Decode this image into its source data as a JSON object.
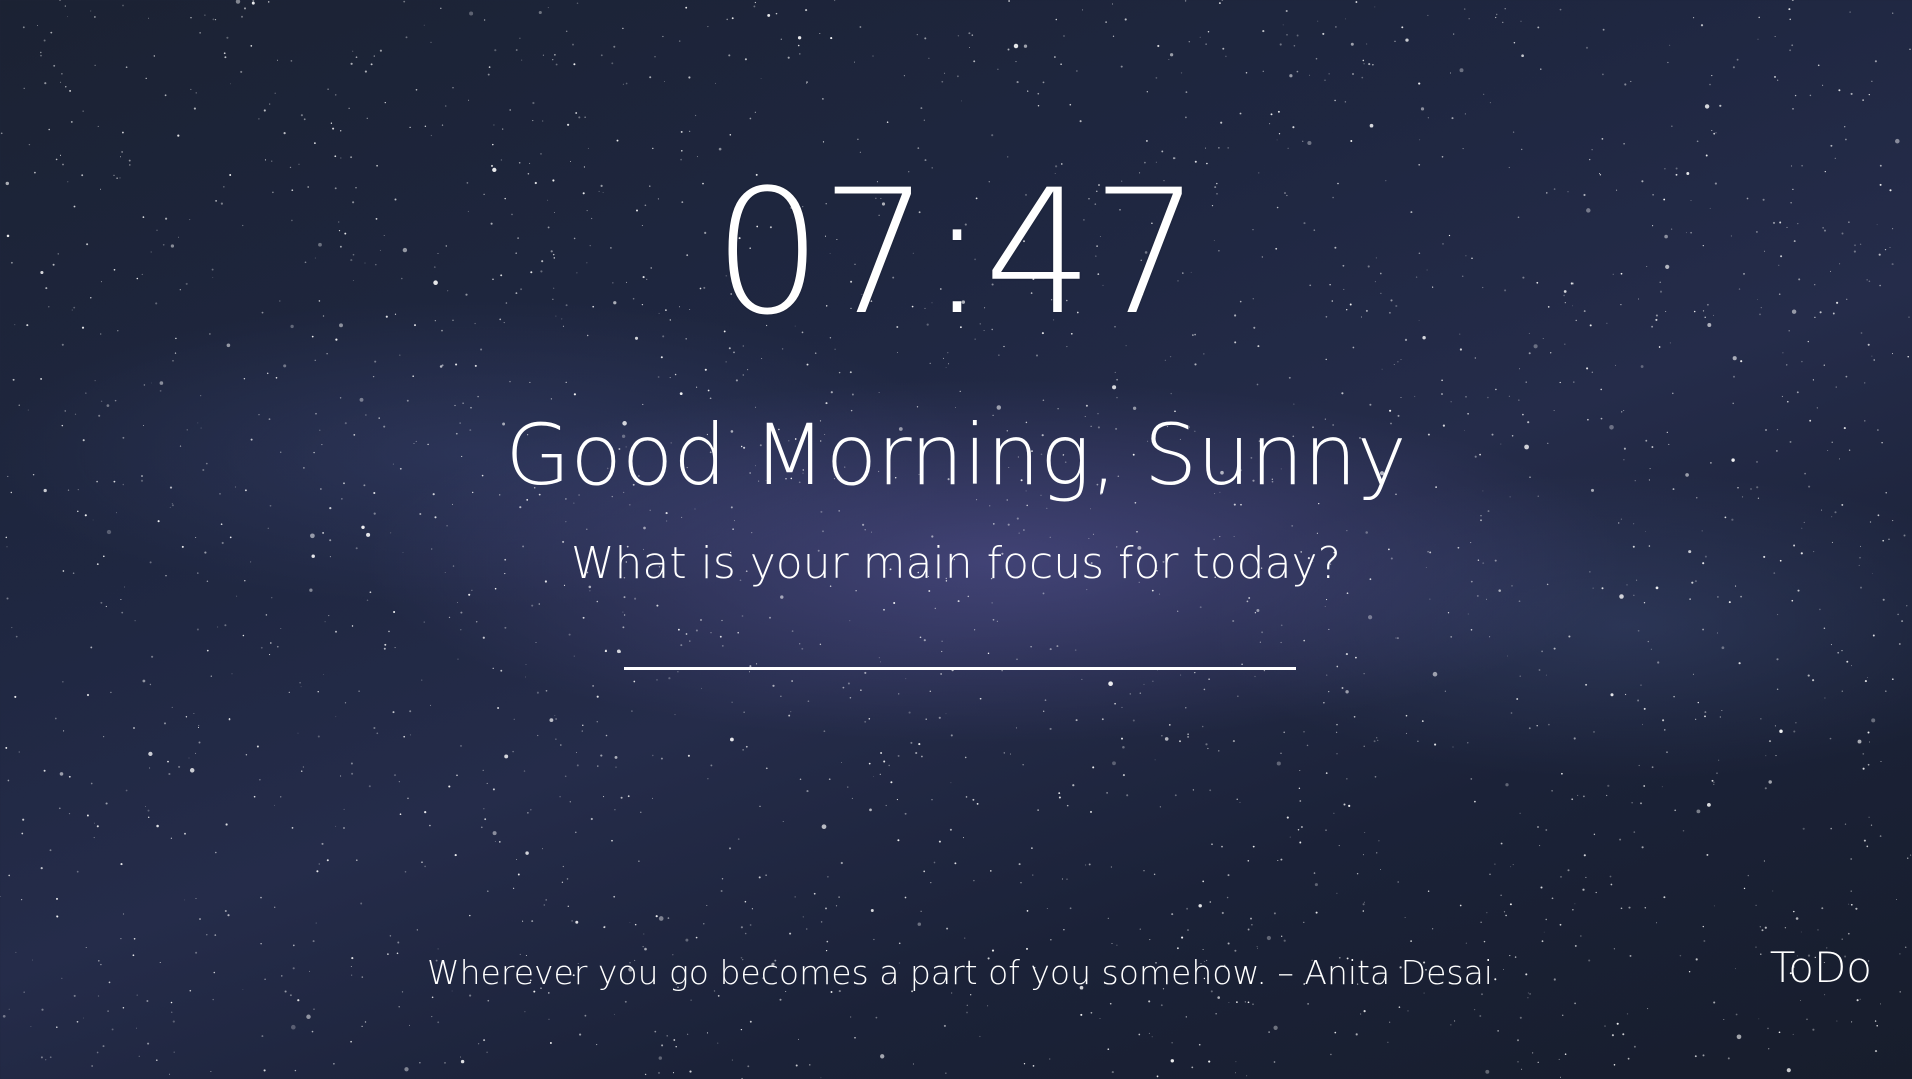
{
  "clock": {
    "time": "07:47"
  },
  "greeting": {
    "text": "Good Morning, Sunny"
  },
  "focus": {
    "question": "What is your main focus for today?",
    "value": ""
  },
  "quote": {
    "text": "Wherever you go becomes a part of you somehow. – Anita Desai"
  },
  "todo": {
    "label": "ToDo"
  },
  "colors": {
    "text": "#ffffff",
    "background": "#1f2741"
  }
}
